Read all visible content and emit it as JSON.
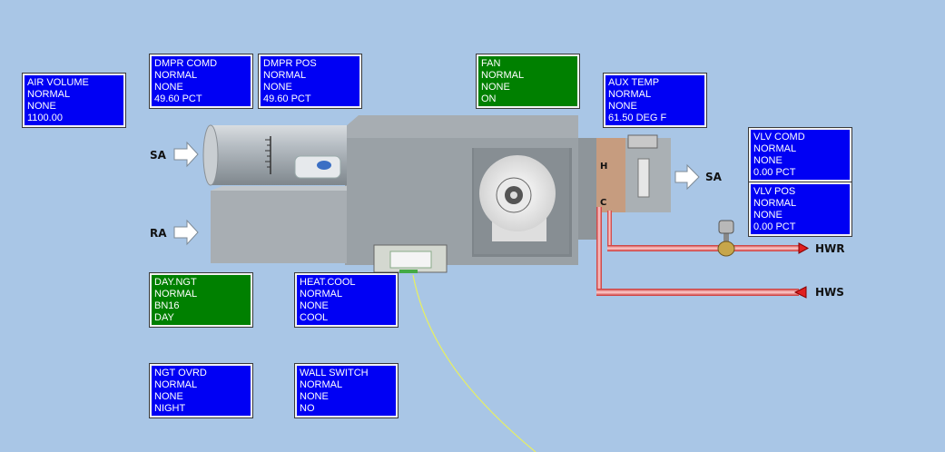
{
  "colors": {
    "background": "#a9c6e6",
    "point_blue": "#0000f4",
    "point_green": "#008000",
    "hot_pipe": "#f08080"
  },
  "points": {
    "air_volume": {
      "name": "AIR VOLUME",
      "status": "NORMAL",
      "priority": "NONE",
      "value": "1100.00"
    },
    "dmpr_comd": {
      "name": "DMPR COMD",
      "status": "NORMAL",
      "priority": "NONE",
      "value": "49.60 PCT"
    },
    "dmpr_pos": {
      "name": "DMPR POS",
      "status": "NORMAL",
      "priority": "NONE",
      "value": "49.60 PCT"
    },
    "fan": {
      "name": "FAN",
      "status": "NORMAL",
      "priority": "NONE",
      "value": "ON"
    },
    "aux_temp": {
      "name": "AUX TEMP",
      "status": "NORMAL",
      "priority": "NONE",
      "value": "61.50 DEG F"
    },
    "vlv_comd": {
      "name": "VLV COMD",
      "status": "NORMAL",
      "priority": "NONE",
      "value": "0.00 PCT"
    },
    "vlv_pos": {
      "name": "VLV POS",
      "status": "NORMAL",
      "priority": "NONE",
      "value": "0.00 PCT"
    },
    "day_ngt": {
      "name": "DAY.NGT",
      "status": "NORMAL",
      "priority": "BN16",
      "value": "DAY"
    },
    "heat_cool": {
      "name": "HEAT.COOL",
      "status": "NORMAL",
      "priority": "NONE",
      "value": "COOL"
    },
    "ngt_ovrd": {
      "name": "NGT OVRD",
      "status": "NORMAL",
      "priority": "NONE",
      "value": "NIGHT"
    },
    "wall_switch": {
      "name": "WALL SWITCH",
      "status": "NORMAL",
      "priority": "NONE",
      "value": "NO"
    }
  },
  "labels": {
    "sa_in": "SA",
    "ra": "RA",
    "sa_out": "SA",
    "coil_h": "H",
    "coil_c": "C",
    "hwr": "HWR",
    "hws": "HWS"
  }
}
